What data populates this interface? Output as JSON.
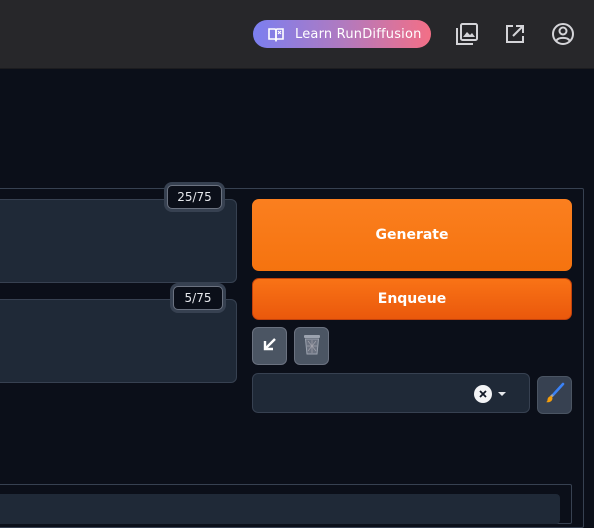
{
  "header": {
    "learn_button_label": "Learn RunDiffusion",
    "icons": [
      "gallery-icon",
      "external-link-icon",
      "account-icon"
    ]
  },
  "prompt": {
    "positive_token_count": "25/75",
    "negative_token_count": "5/75"
  },
  "actions": {
    "generate_label": "Generate",
    "enqueue_label": "Enqueue"
  },
  "styles": {
    "selected_value": ""
  },
  "colors": {
    "accent_orange": "#f97316",
    "background": "#0b0f19",
    "topbar": "#27272a",
    "panel": "#1f2937"
  }
}
